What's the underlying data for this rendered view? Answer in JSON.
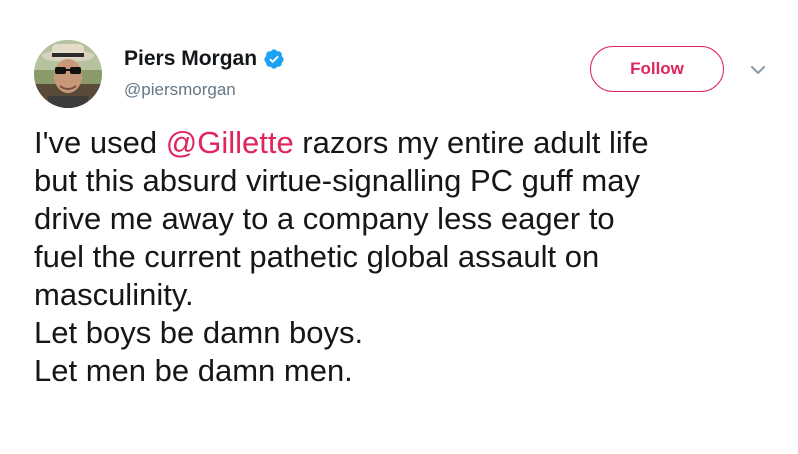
{
  "author": {
    "display_name": "Piers Morgan",
    "handle": "@piersmorgan",
    "verified": true
  },
  "actions": {
    "follow_label": "Follow"
  },
  "tweet": {
    "line1_pre": "I've used ",
    "mention": "@Gillette",
    "line1_post": " razors my entire adult life",
    "line2": "but this absurd virtue-signalling PC guff may",
    "line3": "drive me away to a company less eager to",
    "line4": "fuel the current pathetic global assault on",
    "line5": "masculinity.",
    "line6": "Let boys be damn boys.",
    "line7": "Let men be damn men."
  },
  "colors": {
    "accent": "#e0245e",
    "verified": "#1da1f2",
    "text": "#14171a",
    "secondary": "#657786"
  },
  "icons": {
    "verified": "verified-badge-icon",
    "caret": "chevron-down-icon",
    "avatar": "avatar"
  }
}
